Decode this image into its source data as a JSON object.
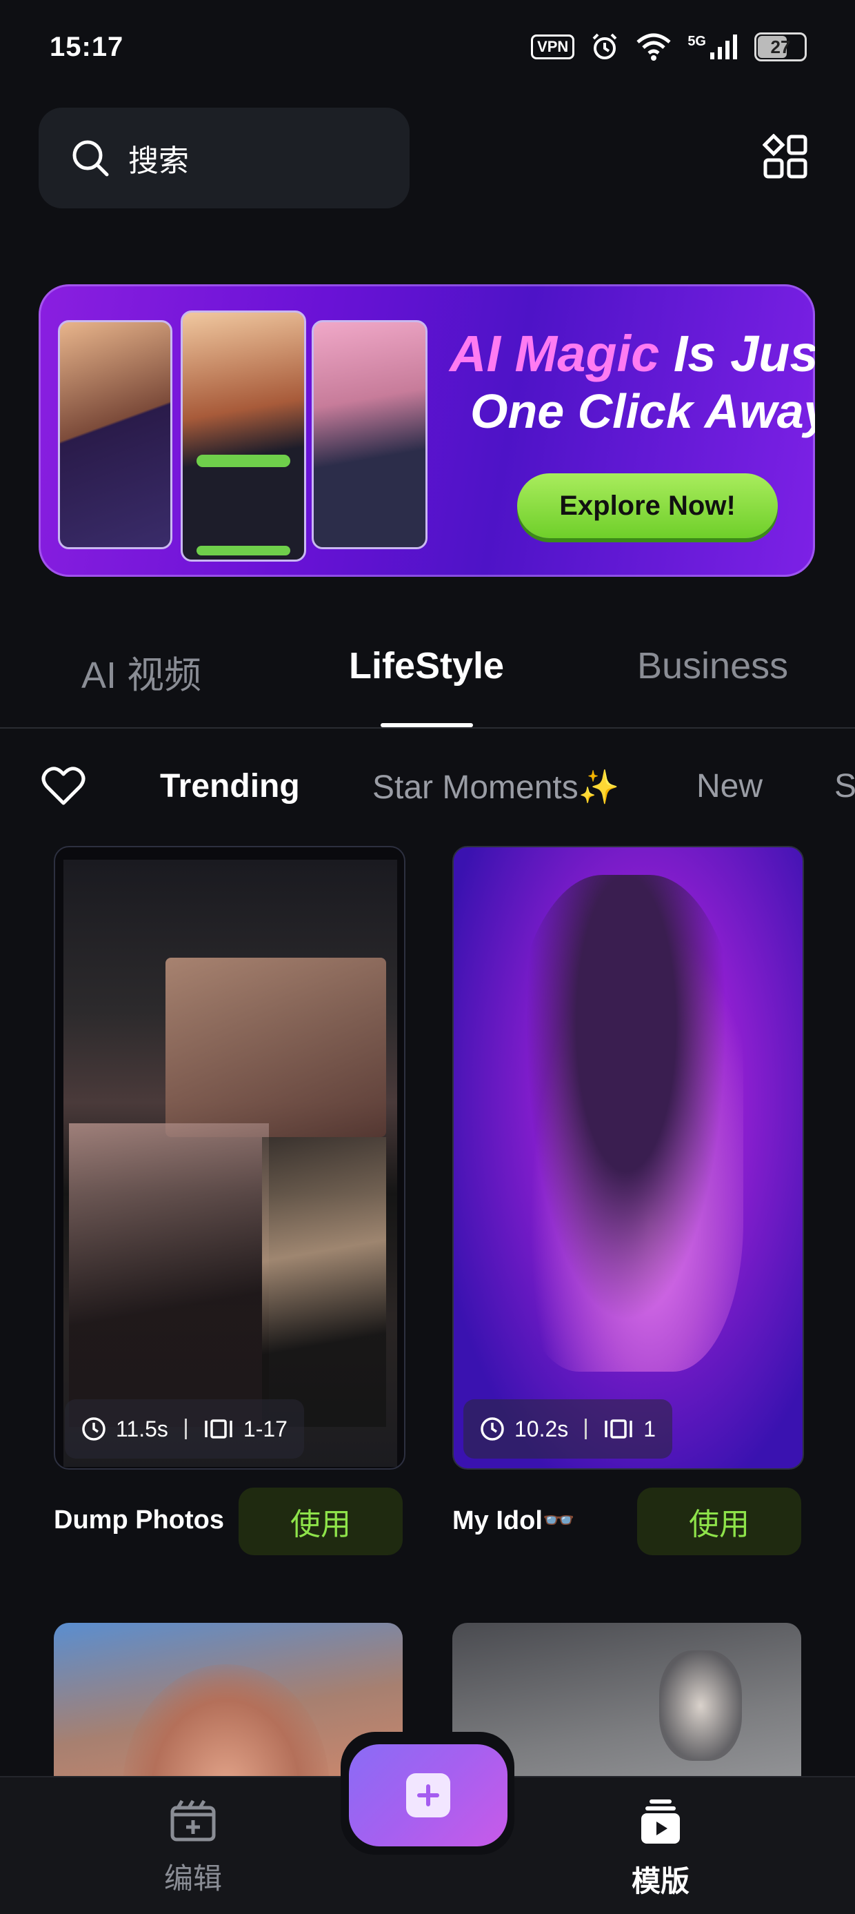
{
  "status_bar": {
    "time": "15:17",
    "vpn": "VPN",
    "network": "5G",
    "battery": "27"
  },
  "search": {
    "label": "搜索"
  },
  "banner": {
    "title_highlight": "AI Magic",
    "title_rest": " Is Just",
    "subtitle": "One Click Away!",
    "cta": "Explore Now!"
  },
  "top_tabs": [
    {
      "label": "AI 视频",
      "active": false
    },
    {
      "label": "LifeStyle",
      "active": true
    },
    {
      "label": "Business",
      "active": false
    }
  ],
  "sub_tabs": [
    {
      "label": "Trending",
      "active": true
    },
    {
      "label": "Star Moments✨",
      "active": false
    },
    {
      "label": "New",
      "active": false
    },
    {
      "label": "S",
      "active": false
    }
  ],
  "templates": [
    {
      "title": "Dump Photos",
      "duration": "11.5s",
      "clips": "1-17",
      "use_label": "使用"
    },
    {
      "title": "My Idol👓",
      "duration": "10.2s",
      "clips": "1",
      "use_label": "使用"
    }
  ],
  "bottom_nav": {
    "edit": "编辑",
    "templates": "模版"
  },
  "colors": {
    "background": "#0e0f13",
    "accent_green": "#8ee34a",
    "banner_purple": "#6a12d6"
  }
}
